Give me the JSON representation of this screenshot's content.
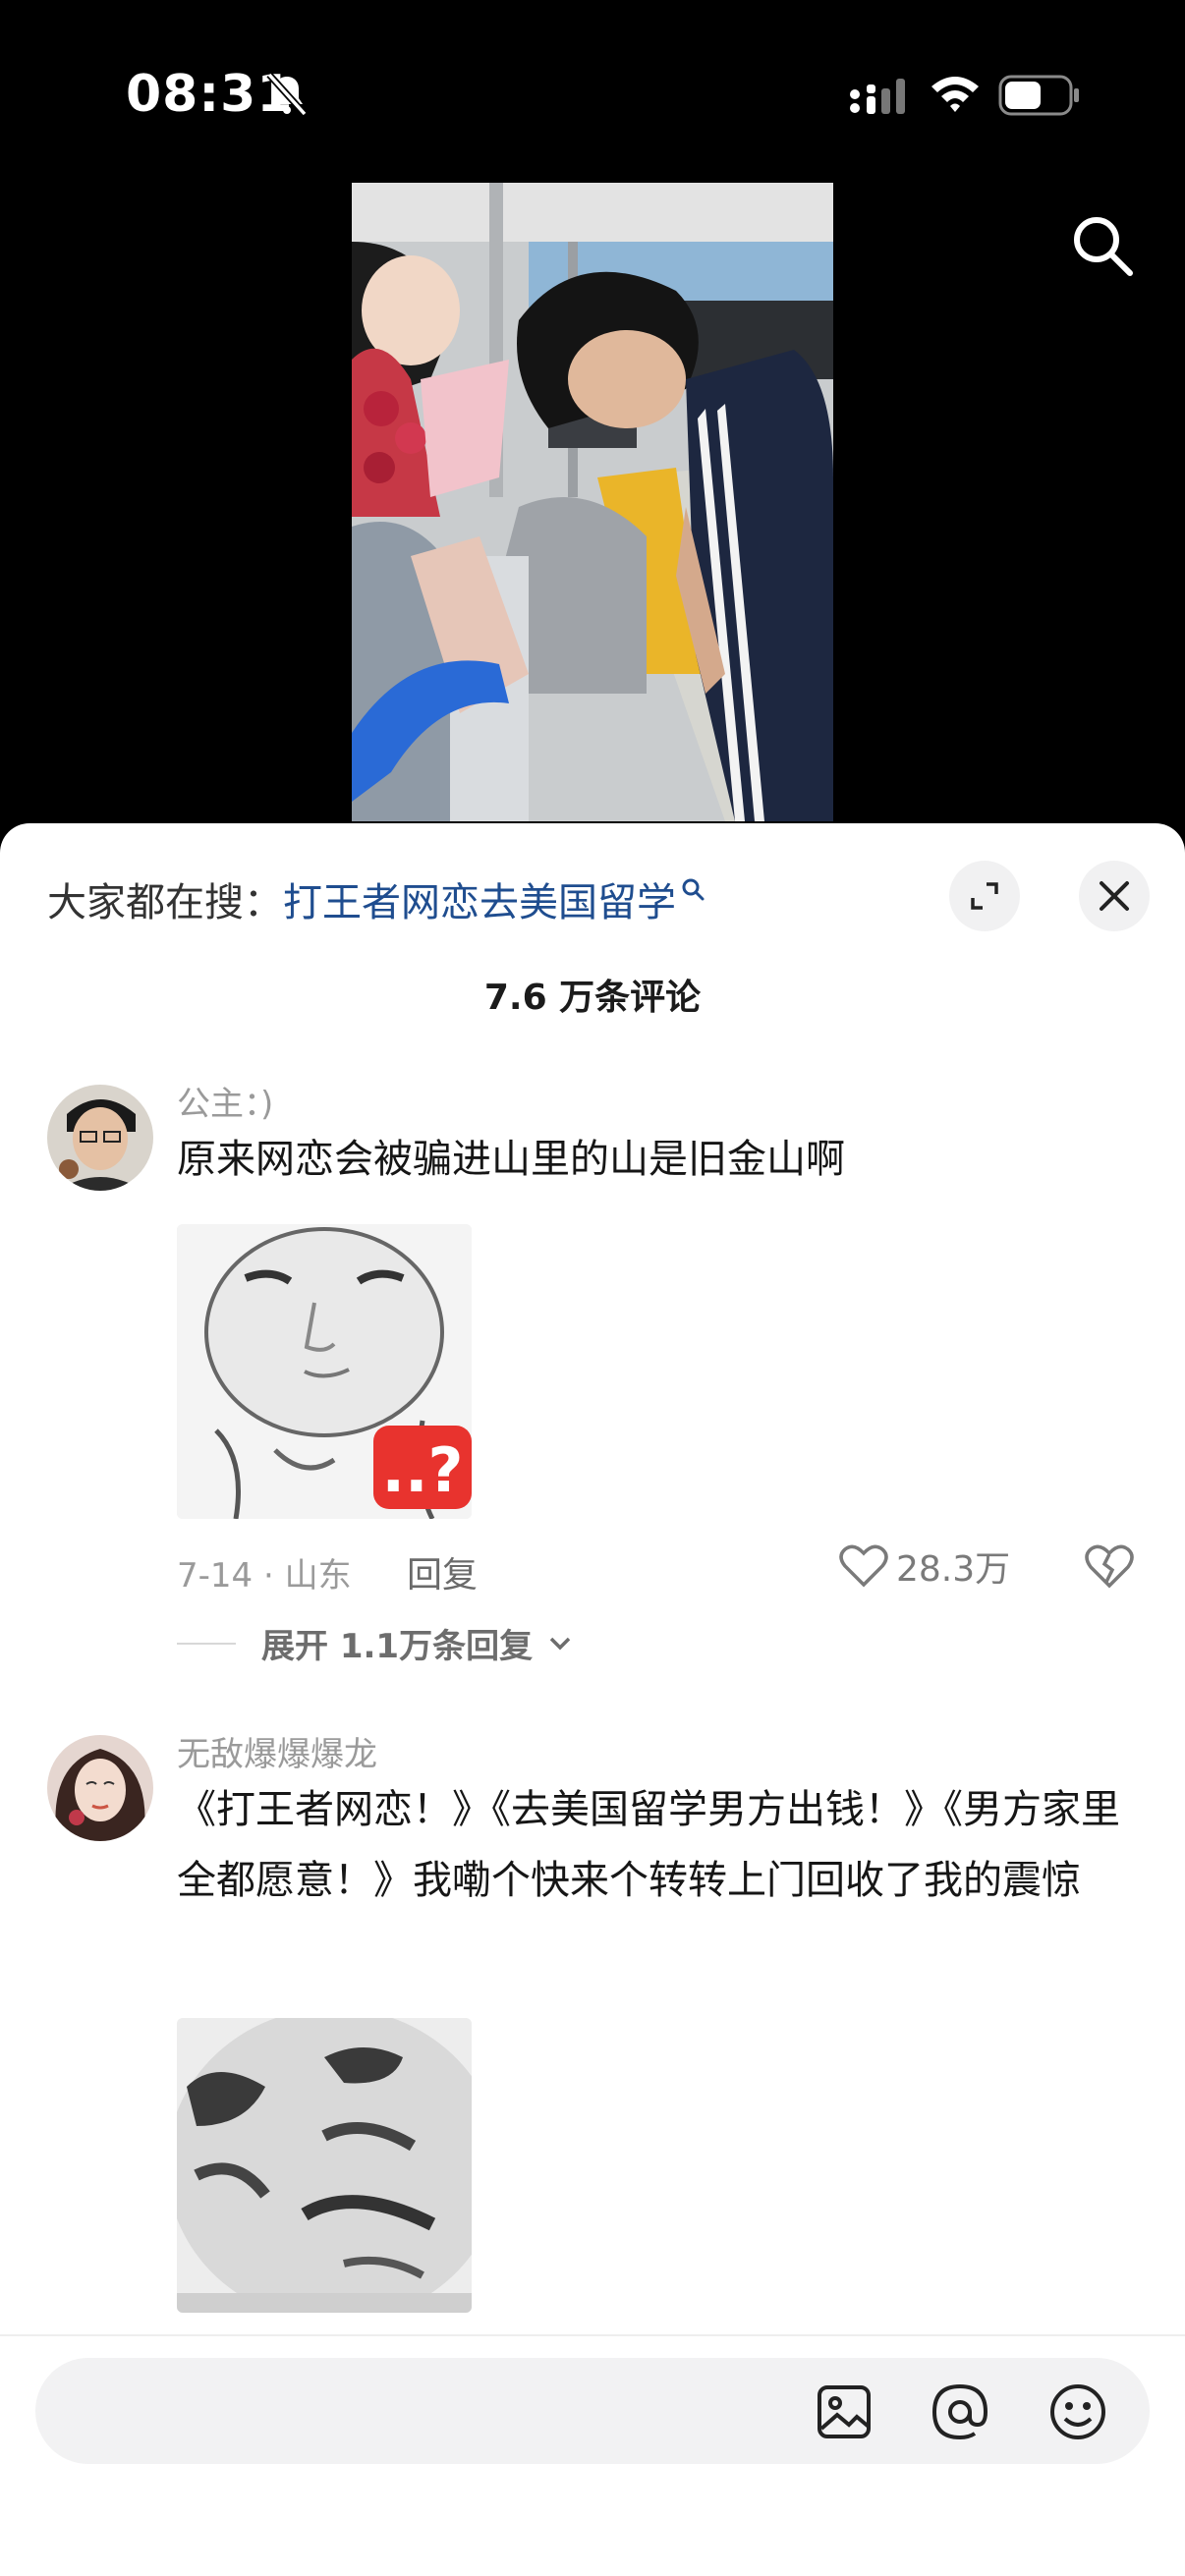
{
  "status_bar": {
    "time": "08:31"
  },
  "sheet": {
    "search_hint_prefix": "大家都在搜：",
    "search_hint_keyword": "打王者网恋去美国留学",
    "comment_count_title": "7.6 万条评论"
  },
  "comments": [
    {
      "username": "公主：)",
      "text": "原来网恋会被骗进山里的山是旧金山啊",
      "meta": "7-14 · 山东",
      "reply_label": "回复",
      "likes": "28.3万",
      "expand_replies": "展开 1.1万条回复"
    },
    {
      "username": "无敌爆爆爆龙",
      "text": "《打王者网恋！》《去美国留学男方出钱！》《男方家里全都愿意！》我嘞个快来个转转上门回收了我的震惊"
    }
  ],
  "input": {
    "placeholder": ""
  },
  "colors": {
    "keyword": "#1f4d8f",
    "sheet_bg": "#ffffff",
    "pill_bg": "#f2f2f3"
  }
}
